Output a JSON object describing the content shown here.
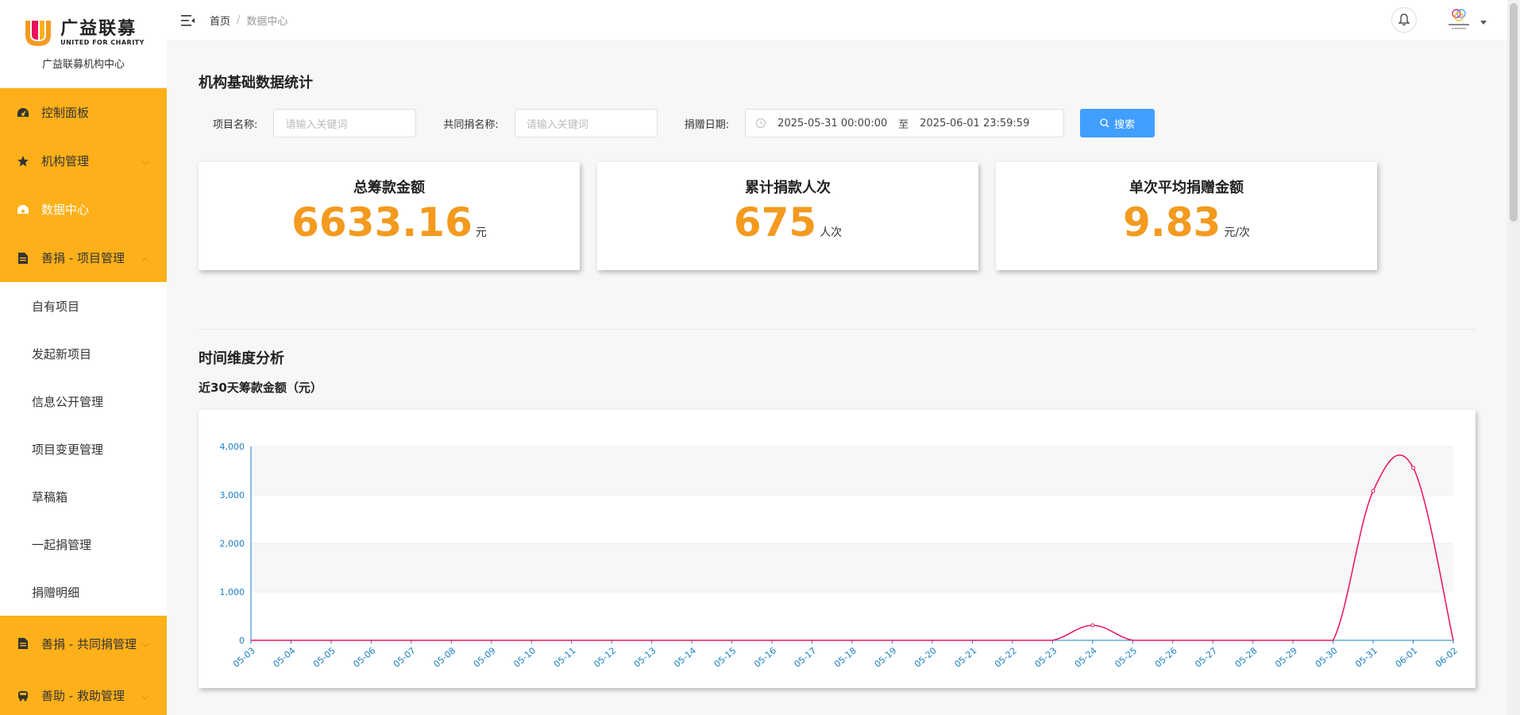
{
  "sidebar": {
    "logo": {
      "cn": "广益联募",
      "en": "UNITED FOR CHARITY",
      "subtitle": "广益联募机构中心"
    },
    "items": [
      {
        "label": "控制面板",
        "icon": "dashboard-icon"
      },
      {
        "label": "机构管理",
        "icon": "star-icon"
      },
      {
        "label": "数据中心",
        "icon": "data-icon"
      },
      {
        "label": "善捐 - 项目管理",
        "icon": "document-icon"
      }
    ],
    "subitems": [
      "自有项目",
      "发起新项目",
      "信息公开管理",
      "项目变更管理",
      "草稿箱",
      "一起捐管理",
      "捐赠明细"
    ],
    "bottom_items": [
      {
        "label": "善捐 - 共同捐管理",
        "icon": "document-icon"
      },
      {
        "label": "善助 - 救助管理",
        "icon": "bus-icon"
      }
    ]
  },
  "breadcrumb": {
    "home": "首页",
    "sep": "/",
    "current": "数据中心"
  },
  "stats_section": {
    "title": "机构基础数据统计",
    "filters": {
      "project_label": "项目名称:",
      "project_placeholder": "请输入关键词",
      "joint_label": "共同捐名称:",
      "joint_placeholder": "请输入关键词",
      "date_label": "捐赠日期:",
      "date_start": "2025-05-31 00:00:00",
      "date_to": "至",
      "date_end": "2025-06-01 23:59:59",
      "search_label": "搜索"
    },
    "cards": [
      {
        "title": "总筹款金额",
        "value": "6633.16",
        "unit": "元"
      },
      {
        "title": "累计捐款人次",
        "value": "675",
        "unit": "人次"
      },
      {
        "title": "单次平均捐赠金额",
        "value": "9.83",
        "unit": "元/次"
      }
    ]
  },
  "time_section": {
    "title": "时间维度分析",
    "subtitle": "近30天筹款金额（元）"
  },
  "colors": {
    "sidebar_accent": "#fdb019",
    "stat_value": "#f39a1f",
    "primary": "#409eff",
    "line": "#e8135a",
    "axis": "#1a7fc4"
  },
  "chart_data": {
    "type": "line",
    "title": "",
    "xlabel": "",
    "ylabel": "",
    "ylim": [
      0,
      4000
    ],
    "yticks": [
      "0",
      "1,000",
      "2,000",
      "3,000",
      "4,000"
    ],
    "grid": true,
    "categories": [
      "05-03",
      "05-04",
      "05-05",
      "05-06",
      "05-07",
      "05-08",
      "05-09",
      "05-10",
      "05-11",
      "05-12",
      "05-13",
      "05-14",
      "05-15",
      "05-16",
      "05-17",
      "05-18",
      "05-19",
      "05-20",
      "05-21",
      "05-22",
      "05-23",
      "05-24",
      "05-25",
      "05-26",
      "05-27",
      "05-28",
      "05-29",
      "05-30",
      "05-31",
      "06-01",
      "06-02"
    ],
    "series": [
      {
        "values": [
          0,
          0,
          0,
          0,
          0,
          0,
          0,
          0,
          0,
          0,
          0,
          0,
          0,
          0,
          0,
          0,
          0,
          0,
          0,
          0,
          0,
          310,
          0,
          0,
          0,
          0,
          0,
          0,
          3080,
          3560,
          0
        ]
      }
    ]
  }
}
